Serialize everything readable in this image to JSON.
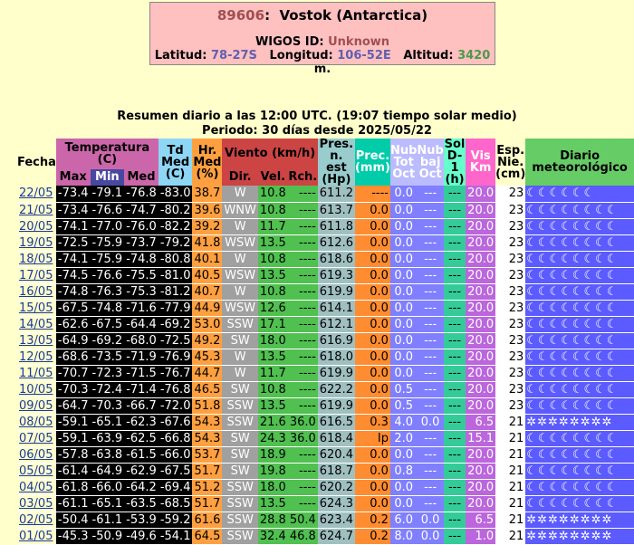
{
  "station": {
    "id": "89606",
    "name": "Vostok (Antarctica)",
    "wigos_label": "WIGOS ID:",
    "wigos_value": "Unknown",
    "lat_label": "Latitud:",
    "lat_value": "78-27S",
    "lon_label": "Longitud:",
    "lon_value": "106-52E",
    "alt_label": "Altitud:",
    "alt_value": "3420",
    "alt_unit": "m."
  },
  "summary": {
    "line1": "Resumen diario a las 12:00 UTC. (19:07 tiempo solar medio)",
    "line2": "Periodo: 30 días desde 2025/05/22"
  },
  "headers": {
    "fecha": "Fecha",
    "temp_group": "Temperatura (C)",
    "max": "Max",
    "min": "Min",
    "med": "Med",
    "td": "Td Med (C)",
    "hr": "Hr. Med (%)",
    "viento_group": "Viento (km/h)",
    "dir": "Dir.",
    "vel": "Vel.",
    "rch": "Rch.",
    "pres": "Pres. n. est (Hp)",
    "prec": "Prec. (mm)",
    "nub_tot": "Nub Tot Oct",
    "nub_baj": "Nub baj Oct",
    "sol": "Sol D-1 (h)",
    "vis": "Vis Km",
    "esp": "Esp. Nie. (cm)",
    "diario": "Diario meteorológico"
  },
  "colors": {
    "background": "#ffffcc",
    "header_box": "#ffc0c0",
    "temp_header": "#cc66aa",
    "min_header": "#4848a0",
    "td_header": "#8ed6f6",
    "hr_header": "#ffa040",
    "viento_header": "#cc4444",
    "pres_header": "#99cccc",
    "prec_header": "#00ccaa",
    "nub_header": "#bbbbff",
    "sol_header": "#66ffcc",
    "vis_header": "#ff66cc",
    "diario_header": "#66cc66"
  },
  "rows": [
    {
      "date": "22/05",
      "max": "-73.4",
      "min": "-79.1",
      "med": "-76.8",
      "td": "-83.0",
      "hr": "38.7",
      "dir": "W",
      "vel": "10.8",
      "rch": "----",
      "pres": "611.2",
      "prec": "----",
      "nubt": "0.0",
      "nubb": "---",
      "sol": "---",
      "vis": "20.0",
      "esp": "23",
      "diario": "☾☾☾☾☾☾"
    },
    {
      "date": "21/05",
      "max": "-73.4",
      "min": "-76.6",
      "med": "-74.7",
      "td": "-80.2",
      "hr": "39.6",
      "dir": "WNW",
      "vel": "10.8",
      "rch": "----",
      "pres": "613.7",
      "prec": "0.0",
      "nubt": "0.0",
      "nubb": "---",
      "sol": "---",
      "vis": "20.0",
      "esp": "23",
      "diario": "☾☾☾☾☾☾☾☾"
    },
    {
      "date": "20/05",
      "max": "-74.1",
      "min": "-77.0",
      "med": "-76.0",
      "td": "-82.2",
      "hr": "39.2",
      "dir": "W",
      "vel": "11.7",
      "rch": "----",
      "pres": "611.8",
      "prec": "0.0",
      "nubt": "0.0",
      "nubb": "---",
      "sol": "---",
      "vis": "20.0",
      "esp": "23",
      "diario": "☾☾☾☾☾☾☾☾"
    },
    {
      "date": "19/05",
      "max": "-72.5",
      "min": "-75.9",
      "med": "-73.7",
      "td": "-79.2",
      "hr": "41.8",
      "dir": "WSW",
      "vel": "13.5",
      "rch": "----",
      "pres": "612.6",
      "prec": "0.0",
      "nubt": "0.0",
      "nubb": "---",
      "sol": "---",
      "vis": "20.0",
      "esp": "23",
      "diario": "☾☾☾☾☾☾☾☾"
    },
    {
      "date": "18/05",
      "max": "-74.1",
      "min": "-75.9",
      "med": "-74.8",
      "td": "-80.8",
      "hr": "40.1",
      "dir": "W",
      "vel": "10.8",
      "rch": "----",
      "pres": "618.6",
      "prec": "0.0",
      "nubt": "0.0",
      "nubb": "---",
      "sol": "---",
      "vis": "20.0",
      "esp": "23",
      "diario": "☾☾☾☾☾☾☾☾"
    },
    {
      "date": "17/05",
      "max": "-74.5",
      "min": "-76.6",
      "med": "-75.5",
      "td": "-81.0",
      "hr": "40.5",
      "dir": "WSW",
      "vel": "13.5",
      "rch": "----",
      "pres": "619.3",
      "prec": "0.0",
      "nubt": "0.0",
      "nubb": "---",
      "sol": "---",
      "vis": "20.0",
      "esp": "23",
      "diario": "☾☾☾☾☾☾☾☾"
    },
    {
      "date": "16/05",
      "max": "-74.8",
      "min": "-76.3",
      "med": "-75.3",
      "td": "-81.2",
      "hr": "40.7",
      "dir": "W",
      "vel": "10.8",
      "rch": "----",
      "pres": "619.9",
      "prec": "0.0",
      "nubt": "0.0",
      "nubb": "---",
      "sol": "---",
      "vis": "20.0",
      "esp": "23",
      "diario": "☾☾☾☾☾☾☾☾"
    },
    {
      "date": "15/05",
      "max": "-67.5",
      "min": "-74.8",
      "med": "-71.6",
      "td": "-77.9",
      "hr": "44.9",
      "dir": "WSW",
      "vel": "12.6",
      "rch": "----",
      "pres": "614.1",
      "prec": "0.0",
      "nubt": "0.0",
      "nubb": "---",
      "sol": "---",
      "vis": "20.0",
      "esp": "23",
      "diario": "☾☾☾☾☾☾☾☾"
    },
    {
      "date": "14/05",
      "max": "-62.6",
      "min": "-67.5",
      "med": "-64.4",
      "td": "-69.2",
      "hr": "53.0",
      "dir": "SSW",
      "vel": "17.1",
      "rch": "----",
      "pres": "612.1",
      "prec": "0.0",
      "nubt": "0.0",
      "nubb": "---",
      "sol": "---",
      "vis": "20.0",
      "esp": "23",
      "diario": "☾☾☾☾☾☾☾☾"
    },
    {
      "date": "13/05",
      "max": "-64.9",
      "min": "-69.2",
      "med": "-68.0",
      "td": "-72.5",
      "hr": "49.2",
      "dir": "SW",
      "vel": "18.0",
      "rch": "----",
      "pres": "616.9",
      "prec": "0.0",
      "nubt": "0.0",
      "nubb": "---",
      "sol": "---",
      "vis": "20.0",
      "esp": "23",
      "diario": "☾☾☾☾☾☾☾☾"
    },
    {
      "date": "12/05",
      "max": "-68.6",
      "min": "-73.5",
      "med": "-71.9",
      "td": "-76.9",
      "hr": "45.3",
      "dir": "W",
      "vel": "13.5",
      "rch": "----",
      "pres": "618.0",
      "prec": "0.0",
      "nubt": "0.0",
      "nubb": "---",
      "sol": "---",
      "vis": "20.0",
      "esp": "23",
      "diario": "☾☾☾☾☾☾☾☾"
    },
    {
      "date": "11/05",
      "max": "-70.7",
      "min": "-72.3",
      "med": "-71.5",
      "td": "-76.7",
      "hr": "44.7",
      "dir": "W",
      "vel": "11.7",
      "rch": "----",
      "pres": "619.9",
      "prec": "0.0",
      "nubt": "0.0",
      "nubb": "---",
      "sol": "---",
      "vis": "20.0",
      "esp": "23",
      "diario": "☾☾☾☾☾☾☾☾"
    },
    {
      "date": "10/05",
      "max": "-70.3",
      "min": "-72.4",
      "med": "-71.4",
      "td": "-76.8",
      "hr": "46.5",
      "dir": "SW",
      "vel": "10.8",
      "rch": "----",
      "pres": "622.2",
      "prec": "0.0",
      "nubt": "0.5",
      "nubb": "---",
      "sol": "---",
      "vis": "20.0",
      "esp": "23",
      "diario": "☾☾☾☾☾☾☾☾"
    },
    {
      "date": "09/05",
      "max": "-64.7",
      "min": "-70.3",
      "med": "-66.7",
      "td": "-72.0",
      "hr": "51.8",
      "dir": "SSW",
      "vel": "13.5",
      "rch": "----",
      "pres": "619.9",
      "prec": "0.0",
      "nubt": "0.5",
      "nubb": "---",
      "sol": "---",
      "vis": "20.0",
      "esp": "23",
      "diario": "☾☾☾☾☾☾☾☾"
    },
    {
      "date": "08/05",
      "max": "-59.1",
      "min": "-65.1",
      "med": "-62.3",
      "td": "-67.6",
      "hr": "54.3",
      "dir": "SSW",
      "vel": "21.6",
      "rch": "36.0",
      "pres": "616.5",
      "prec": "0.3",
      "nubt": "4.0",
      "nubb": "0.0",
      "sol": "---",
      "vis": "6.5",
      "esp": "21",
      "diario": "✲✲✲✲✲✲✲✲"
    },
    {
      "date": "07/05",
      "max": "-59.1",
      "min": "-63.9",
      "med": "-62.5",
      "td": "-66.8",
      "hr": "54.3",
      "dir": "SW",
      "vel": "24.3",
      "rch": "36.0",
      "pres": "618.4",
      "prec": "Ip",
      "nubt": "2.0",
      "nubb": "---",
      "sol": "---",
      "vis": "15.1",
      "esp": "21",
      "diario": "☾☾☾☾☾☾☾☾"
    },
    {
      "date": "06/05",
      "max": "-57.8",
      "min": "-63.8",
      "med": "-61.5",
      "td": "-66.0",
      "hr": "53.7",
      "dir": "SW",
      "vel": "18.9",
      "rch": "----",
      "pres": "620.4",
      "prec": "0.0",
      "nubt": "0.0",
      "nubb": "---",
      "sol": "---",
      "vis": "20.0",
      "esp": "21",
      "diario": "☾☾☾☾☾☾☾☾"
    },
    {
      "date": "05/05",
      "max": "-61.4",
      "min": "-64.9",
      "med": "-62.9",
      "td": "-67.5",
      "hr": "51.7",
      "dir": "SW",
      "vel": "19.8",
      "rch": "----",
      "pres": "618.7",
      "prec": "0.0",
      "nubt": "0.8",
      "nubb": "---",
      "sol": "---",
      "vis": "20.0",
      "esp": "21",
      "diario": "☾☾☾☾☾☾☾☾"
    },
    {
      "date": "04/05",
      "max": "-61.8",
      "min": "-66.0",
      "med": "-64.2",
      "td": "-69.4",
      "hr": "51.2",
      "dir": "SSW",
      "vel": "18.0",
      "rch": "----",
      "pres": "620.2",
      "prec": "0.0",
      "nubt": "0.0",
      "nubb": "---",
      "sol": "---",
      "vis": "20.0",
      "esp": "21",
      "diario": "☾☾☾☾☾☾☾☾"
    },
    {
      "date": "03/05",
      "max": "-61.1",
      "min": "-65.1",
      "med": "-63.5",
      "td": "-68.5",
      "hr": "51.7",
      "dir": "SSW",
      "vel": "13.5",
      "rch": "----",
      "pres": "624.3",
      "prec": "0.0",
      "nubt": "0.0",
      "nubb": "---",
      "sol": "---",
      "vis": "20.0",
      "esp": "21",
      "diario": "☾☾☾☾☾☾☾☾"
    },
    {
      "date": "02/05",
      "max": "-50.4",
      "min": "-61.1",
      "med": "-53.9",
      "td": "-59.2",
      "hr": "61.6",
      "dir": "SSW",
      "vel": "28.8",
      "rch": "50.4",
      "pres": "623.4",
      "prec": "0.2",
      "nubt": "6.0",
      "nubb": "0.0",
      "sol": "---",
      "vis": "6.5",
      "esp": "21",
      "diario": "✲✲✲✲✲✲✲✲"
    },
    {
      "date": "01/05",
      "max": "-45.3",
      "min": "-50.9",
      "med": "-49.6",
      "td": "-54.1",
      "hr": "64.5",
      "dir": "SSW",
      "vel": "32.4",
      "rch": "46.8",
      "pres": "624.7",
      "prec": "0.2",
      "nubt": "8.0",
      "nubb": "0.0",
      "sol": "---",
      "vis": "1.0",
      "esp": "21",
      "diario": "✲✲✲✲✲✲✲✲"
    }
  ]
}
